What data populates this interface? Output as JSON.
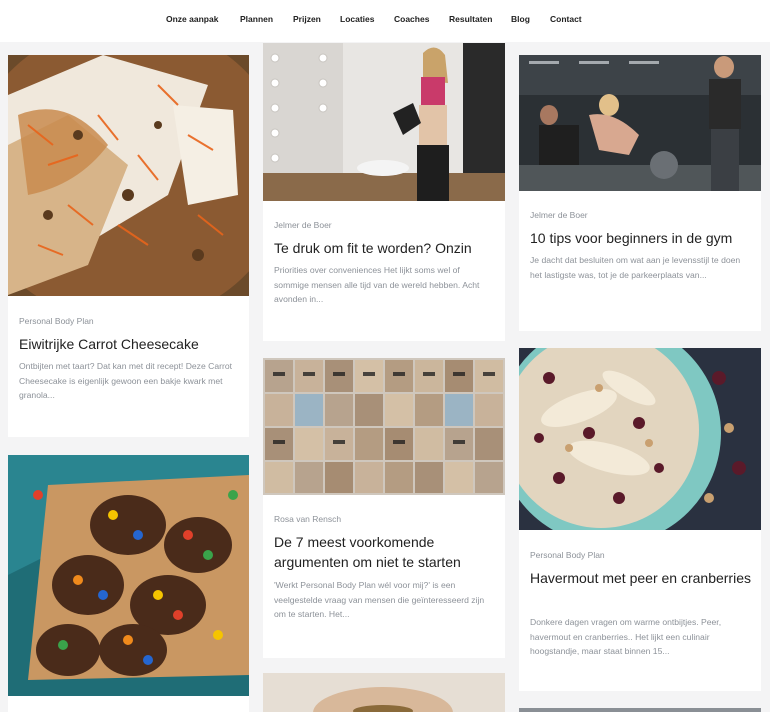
{
  "nav": {
    "items": [
      "Onze aanpak",
      "Plannen",
      "Prijzen",
      "Locaties",
      "Coaches",
      "Resultaten",
      "Blog",
      "Contact"
    ]
  },
  "posts": [
    {
      "category": "Personal Body Plan",
      "title": "Eiwitrijke Carrot Cheesecake",
      "excerpt": "Ontbijten met taart? Dat kan met dit recept! Deze Carrot Cheesecake is eigenlijk gewoon een bakje kwark met granola...",
      "image": "carrot-cheesecake-photo"
    },
    {
      "category": "Jelmer de Boer",
      "title": "Te druk om fit te worden? Onzin",
      "excerpt": "Priorities over conveniences Het lijkt soms wel of sommige mensen alle tijd van de wereld hebben. Acht avonden in...",
      "image": "woman-mirror-photo"
    },
    {
      "category": "Jelmer de Boer",
      "title": "10 tips voor beginners in de gym",
      "excerpt": "Je dacht dat besluiten om wat aan je levensstijl te doen het lastigste was, tot je de parkeerplaats van...",
      "image": "gym-photo"
    },
    {
      "category": "Rosa van Rensch",
      "title": "De 7 meest voorkomende argumenten om niet te starten",
      "excerpt": "'Werkt Personal Body Plan wél voor mij?' is een veelgestelde vraag van mensen die geïnteresseerd zijn om te starten. Het...",
      "image": "before-after-grid-photo"
    },
    {
      "category": "Personal Body Plan",
      "title": "Havermout met peer en cranberries",
      "excerpt": "Donkere dagen vragen om warme ontbijtjes. Peer, havermout en cranberries.. Het lijkt een culinair hoogstandje, maar staat binnen 15...",
      "image": "oatmeal-pear-photo"
    },
    {
      "image": "chocolate-cookies-photo"
    },
    {
      "image": "hands-photo"
    },
    {
      "image": "partial-photo"
    }
  ]
}
